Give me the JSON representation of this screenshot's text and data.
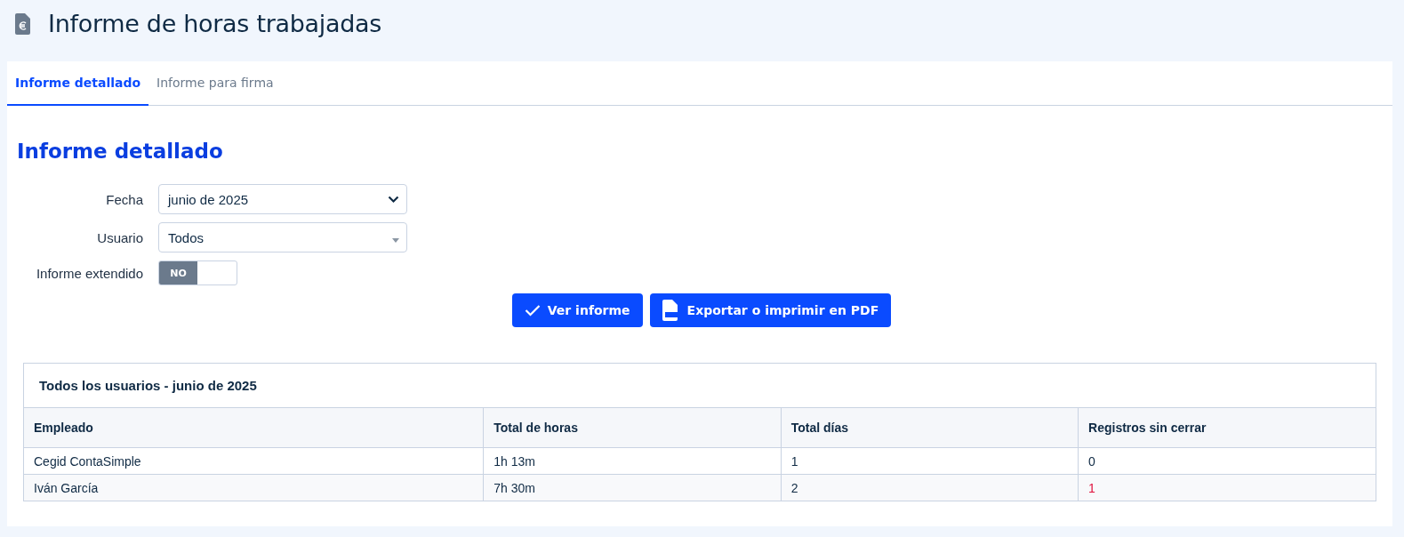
{
  "page": {
    "title": "Informe de horas trabajadas"
  },
  "tabs": [
    {
      "label": "Informe detallado",
      "selected": true
    },
    {
      "label": "Informe para firma",
      "selected": false
    }
  ],
  "section_title": "Informe detallado",
  "form": {
    "date": {
      "label": "Fecha",
      "value": "junio de 2025"
    },
    "user": {
      "label": "Usuario",
      "value": "Todos"
    },
    "extended": {
      "label": "Informe extendido",
      "toggle_text": "NO",
      "on": false
    }
  },
  "buttons": [
    {
      "kind": "view",
      "label": "Ver informe"
    },
    {
      "kind": "pdf",
      "label": "Exportar o imprimir en PDF"
    }
  ],
  "table": {
    "title": "Todos los usuarios - junio de 2025",
    "columns": [
      "Empleado",
      "Total de horas",
      "Total días",
      "Registros sin cerrar"
    ],
    "rows": [
      {
        "cells": [
          "Cegid ContaSimple",
          "1h 13m",
          "1",
          "0"
        ],
        "alert": false
      },
      {
        "cells": [
          "Iván García",
          "7h 30m",
          "2",
          "1"
        ],
        "alert": true
      }
    ]
  }
}
